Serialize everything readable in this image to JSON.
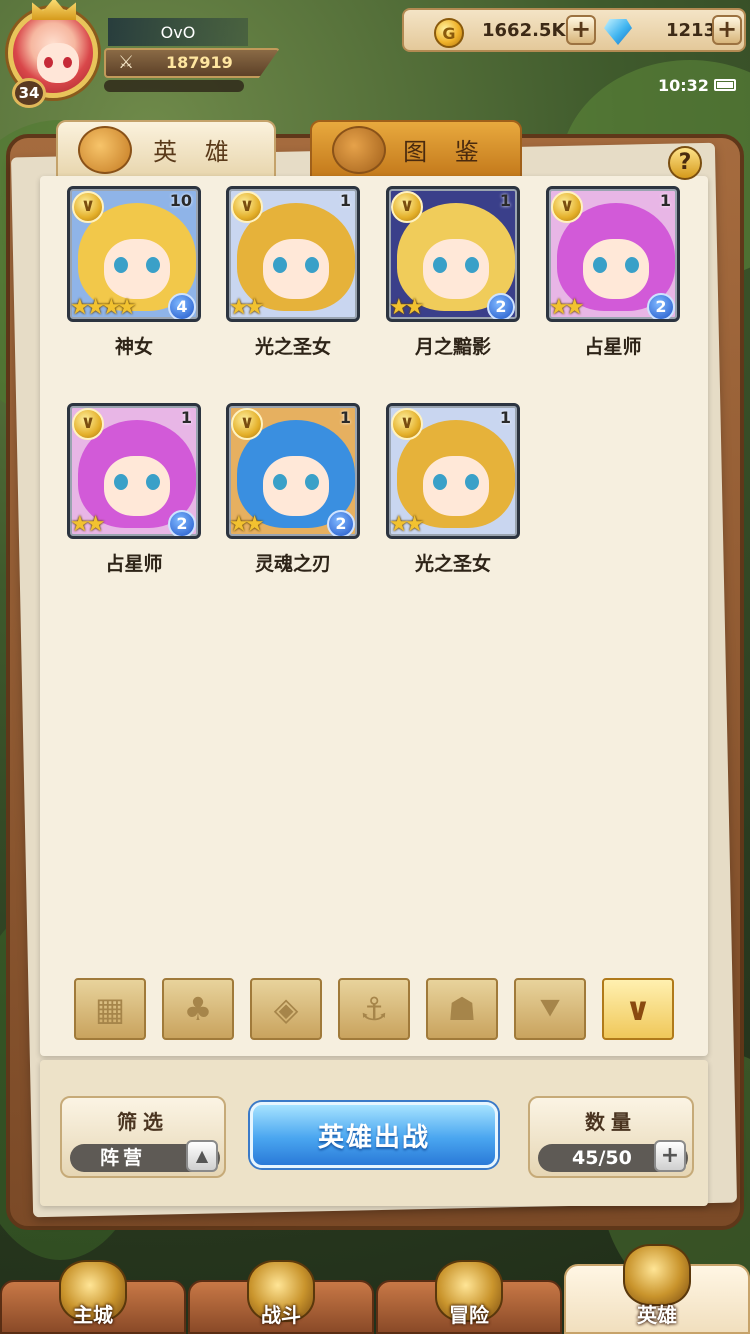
{
  "player": {
    "name": "OvO",
    "level": "34",
    "power": "187919"
  },
  "resources": {
    "gold": "1662.5K",
    "gems": "1213"
  },
  "status": {
    "time": "10:32"
  },
  "tabs": [
    {
      "label": "英 雄",
      "active": true
    },
    {
      "label": "图 鉴",
      "active": false
    }
  ],
  "help_label": "?",
  "heroes": [
    {
      "name": "神女",
      "level": "10",
      "stars": "★★★★",
      "rank": "4",
      "hair": "#f2c84a",
      "bg": "#8fb4e8"
    },
    {
      "name": "光之圣女",
      "level": "1",
      "stars": "★★",
      "rank": "",
      "hair": "#e6b23a",
      "bg": "#c9d6f0"
    },
    {
      "name": "月之黯影",
      "level": "1",
      "stars": "★★",
      "rank": "2",
      "hair": "#f0cc5a",
      "bg": "#3a3f8a"
    },
    {
      "name": "占星师",
      "level": "1",
      "stars": "★★",
      "rank": "2",
      "hair": "#d25ad8",
      "bg": "#e8b6e6"
    },
    {
      "name": "占星师",
      "level": "1",
      "stars": "★★",
      "rank": "2",
      "hair": "#d25ad8",
      "bg": "#e8b6e6"
    },
    {
      "name": "灵魂之刃",
      "level": "1",
      "stars": "★★",
      "rank": "2",
      "hair": "#3a8fe0",
      "bg": "#e6b060"
    },
    {
      "name": "光之圣女",
      "level": "1",
      "stars": "★★",
      "rank": "",
      "hair": "#e6b23a",
      "bg": "#c9d6f0"
    }
  ],
  "faction_filters": [
    {
      "icon": "grid-icon",
      "glyph": "▦",
      "active": false
    },
    {
      "icon": "leaf-icon",
      "glyph": "♣",
      "active": false
    },
    {
      "icon": "diamond-icon",
      "glyph": "◈",
      "active": false
    },
    {
      "icon": "anchor-icon",
      "glyph": "⚓",
      "active": false
    },
    {
      "icon": "beast-icon",
      "glyph": "☗",
      "active": false
    },
    {
      "icon": "wing-icon",
      "glyph": "⯆",
      "active": false
    },
    {
      "icon": "chevron-icon",
      "glyph": "∨",
      "active": true
    }
  ],
  "filter_box": {
    "title": "筛选",
    "value": "阵营",
    "arrow": "▲"
  },
  "deploy_label": "英雄出战",
  "count_box": {
    "title": "数量",
    "value": "45/50"
  },
  "nav": [
    {
      "label": "主城",
      "active": false
    },
    {
      "label": "战斗",
      "active": false
    },
    {
      "label": "冒险",
      "active": false
    },
    {
      "label": "英雄",
      "active": true
    }
  ]
}
